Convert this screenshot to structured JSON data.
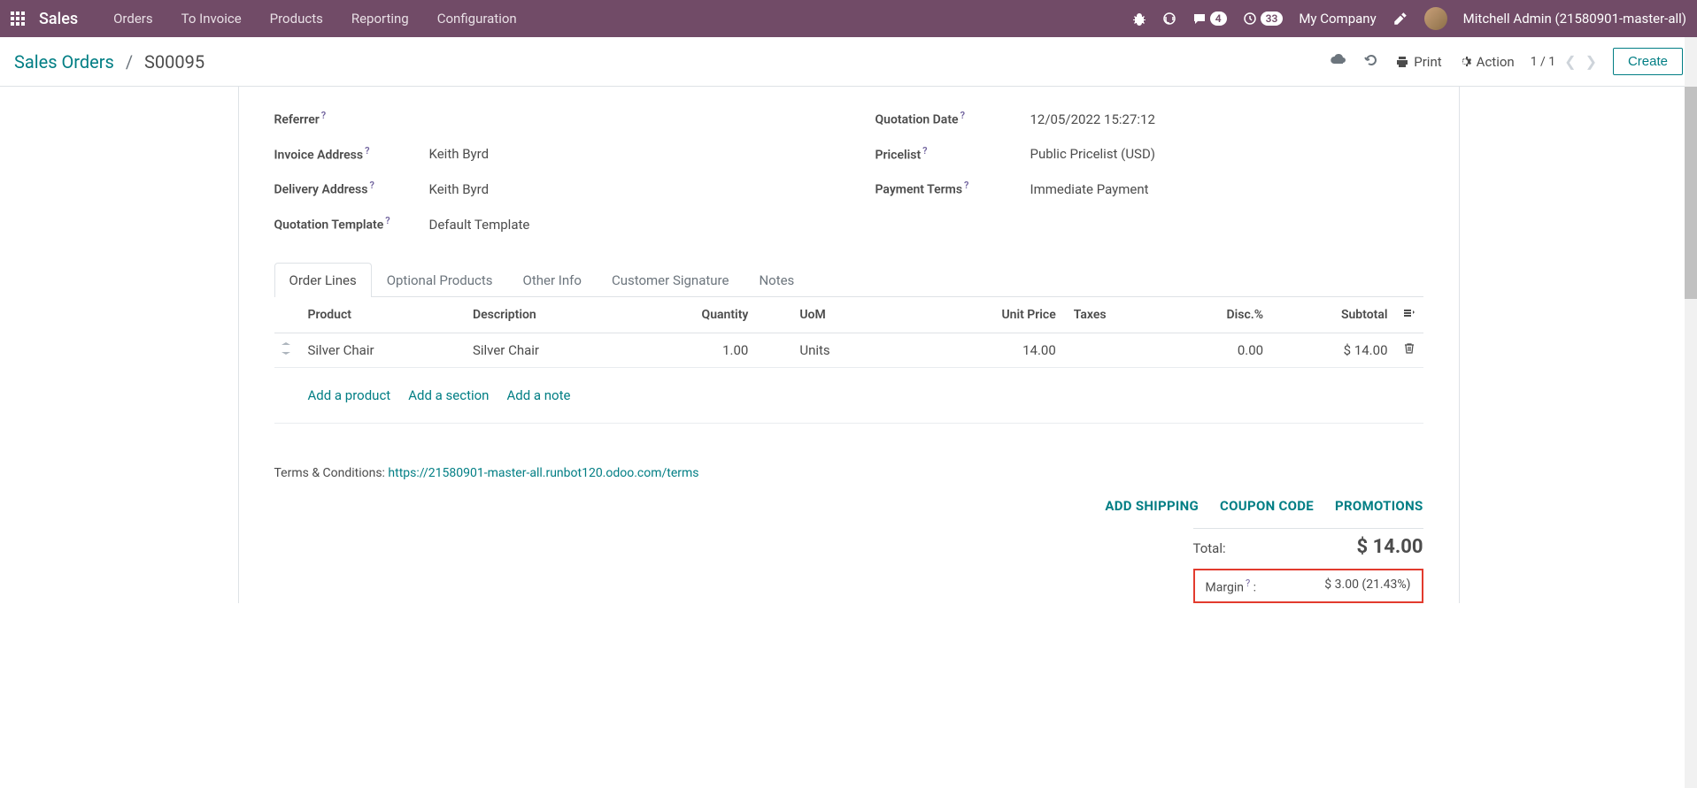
{
  "topbar": {
    "brand": "Sales",
    "nav": [
      "Orders",
      "To Invoice",
      "Products",
      "Reporting",
      "Configuration"
    ],
    "msg_count": "4",
    "activity_count": "33",
    "company": "My Company",
    "user": "Mitchell Admin (21580901-master-all)"
  },
  "control_panel": {
    "breadcrumb_root": "Sales Orders",
    "breadcrumb_current": "S00095",
    "print": "Print",
    "action": "Action",
    "pager": "1 / 1",
    "create": "Create"
  },
  "fields": {
    "referrer_label": "Referrer",
    "referrer_value": "",
    "invoice_addr_label": "Invoice Address",
    "invoice_addr_value": "Keith Byrd",
    "delivery_addr_label": "Delivery Address",
    "delivery_addr_value": "Keith Byrd",
    "quote_tmpl_label": "Quotation Template",
    "quote_tmpl_value": "Default Template",
    "quote_date_label": "Quotation Date",
    "quote_date_value": "12/05/2022 15:27:12",
    "pricelist_label": "Pricelist",
    "pricelist_value": "Public Pricelist (USD)",
    "payment_terms_label": "Payment Terms",
    "payment_terms_value": "Immediate Payment"
  },
  "tabs": [
    "Order Lines",
    "Optional Products",
    "Other Info",
    "Customer Signature",
    "Notes"
  ],
  "table": {
    "headers": {
      "product": "Product",
      "description": "Description",
      "qty": "Quantity",
      "uom": "UoM",
      "unit_price": "Unit Price",
      "taxes": "Taxes",
      "disc": "Disc.%",
      "subtotal": "Subtotal"
    },
    "rows": [
      {
        "product": "Silver Chair",
        "description": "Silver Chair",
        "qty": "1.00",
        "uom": "Units",
        "unit_price": "14.00",
        "taxes": "",
        "disc": "0.00",
        "subtotal": "$ 14.00"
      }
    ],
    "add_product": "Add a product",
    "add_section": "Add a section",
    "add_note": "Add a note"
  },
  "actions": {
    "shipping": "ADD SHIPPING",
    "coupon": "COUPON CODE",
    "promo": "PROMOTIONS"
  },
  "totals": {
    "label": "Total:",
    "value": "$ 14.00"
  },
  "margin": {
    "label": "Margin",
    "value": "$ 3.00 (21.43%)"
  },
  "terms": {
    "label": "Terms & Conditions: ",
    "url": "https://21580901-master-all.runbot120.odoo.com/terms"
  }
}
